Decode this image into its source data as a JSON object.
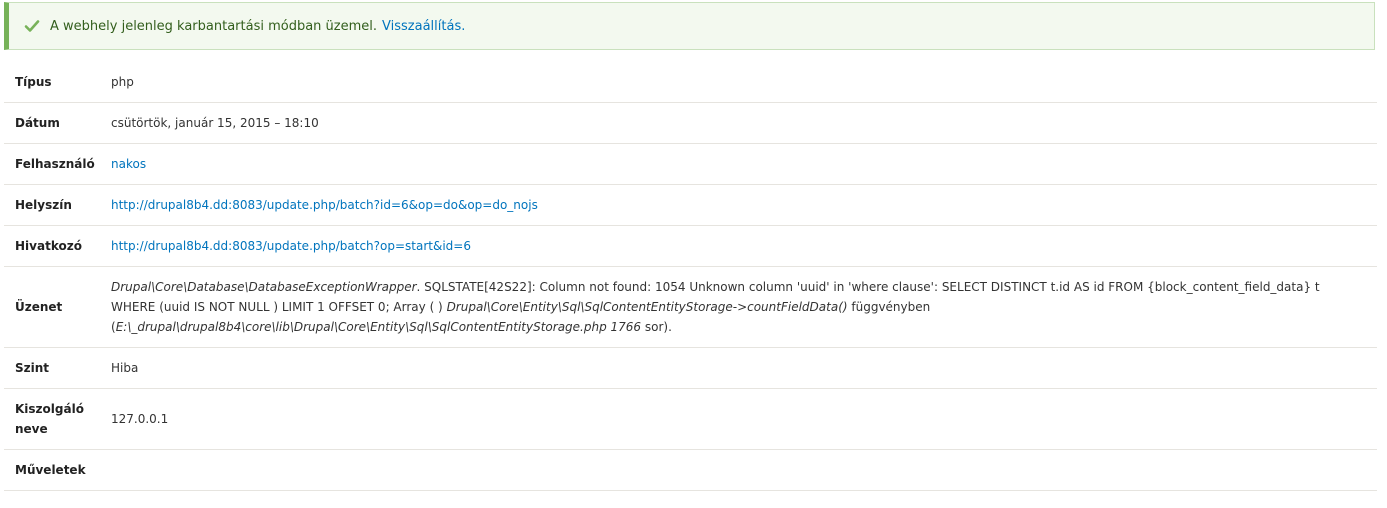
{
  "status": {
    "icon": "check-icon",
    "color": "#77b259",
    "message": "A webhely jelenleg karbantartási módban üzemel.",
    "link_text": "Visszaállítás."
  },
  "details": {
    "type_label": "Típus",
    "type_value": "php",
    "date_label": "Dátum",
    "date_value": "csütörtök, január 15, 2015 – 18:10",
    "user_label": "Felhasználó",
    "user_value": "nakos",
    "location_label": "Helyszín",
    "location_value": "http://drupal8b4.dd:8083/update.php/batch?id=6&op=do&op=do_nojs",
    "referrer_label": "Hivatkozó",
    "referrer_value": "http://drupal8b4.dd:8083/update.php/batch?op=start&id=6",
    "message_label": "Üzenet",
    "message": {
      "exception_class": "Drupal\\Core\\Database\\DatabaseExceptionWrapper",
      "text1": ". SQLSTATE[42S22]: Column not found: 1054 Unknown column 'uuid' in 'where clause': SELECT DISTINCT t.id AS id FROM {block_content_field_data} t WHERE (uuid IS NOT NULL ) LIMIT 1 OFFSET 0; Array ( ) ",
      "function": "Drupal\\Core\\Entity\\Sql\\SqlContentEntityStorage->countFieldData()",
      "text2": " függvényben (",
      "file": "E:\\_drupal\\drupal8b4\\core\\lib\\Drupal\\Core\\Entity\\Sql\\SqlContentEntityStorage.php",
      "line": " 1766",
      "text3": " sor)."
    },
    "severity_label": "Szint",
    "severity_value": "Hiba",
    "hostname_label": "Kiszolgáló neve",
    "hostname_value": "127.0.0.1",
    "operations_label": "Műveletek",
    "operations_value": ""
  }
}
